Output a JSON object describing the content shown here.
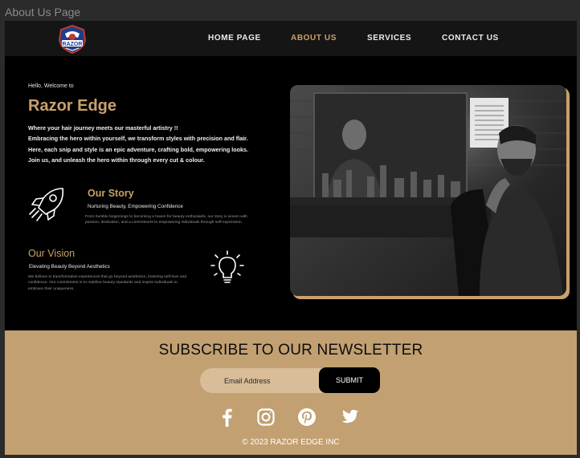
{
  "window": {
    "title": "About Us Page"
  },
  "brand": {
    "logo_text": "RAZOR"
  },
  "nav": {
    "links": [
      {
        "label": "HOME PAGE",
        "active": false
      },
      {
        "label": "ABOUT US",
        "active": true
      },
      {
        "label": "SERVICES",
        "active": false
      },
      {
        "label": "CONTACT US",
        "active": false
      }
    ]
  },
  "hero": {
    "greeting": "Hello, Welcome to",
    "title": "Razor Edge",
    "intro_line1": "Where your hair journey meets our masterful artistry !!",
    "intro_line2": "Embracing the hero within yourself, we transform styles with precision and flair.  Here, each snip and style is an epic adventure, crafting bold, empowering looks.  Join us, and unleash the hero within through every cut & colour."
  },
  "story": {
    "title": "Our Story",
    "subtitle": "Nurturing Beauty, Empowering Confidence",
    "body": "From humble beginnings to becoming a haven for beauty enthusiasts, our story is woven with passion, dedication, and a commitment to empowering individuals through self-expression."
  },
  "vision": {
    "title": "Our Vision",
    "subtitle": "Elevating Beauty Beyond Aesthetics",
    "body": "We believe in transformative experiences that go beyond aesthetics, fostering self-love and confidence. Our commitment is to redefine beauty standards and inspire individuals to embrace their uniqueness."
  },
  "newsletter": {
    "title": "SUBSCRIBE TO OUR NEWSLETTER",
    "email_placeholder": "Email Address",
    "submit_label": "SUBMIT"
  },
  "socials": [
    "facebook-icon",
    "instagram-icon",
    "pinterest-icon",
    "twitter-icon"
  ],
  "footer": {
    "copyright": "© 2023 RAZOR EDGE INC"
  },
  "colors": {
    "accent": "#c9a16a",
    "newsletter_bg": "#c2a072",
    "page_bg": "#000000",
    "nav_bg": "#151515"
  }
}
